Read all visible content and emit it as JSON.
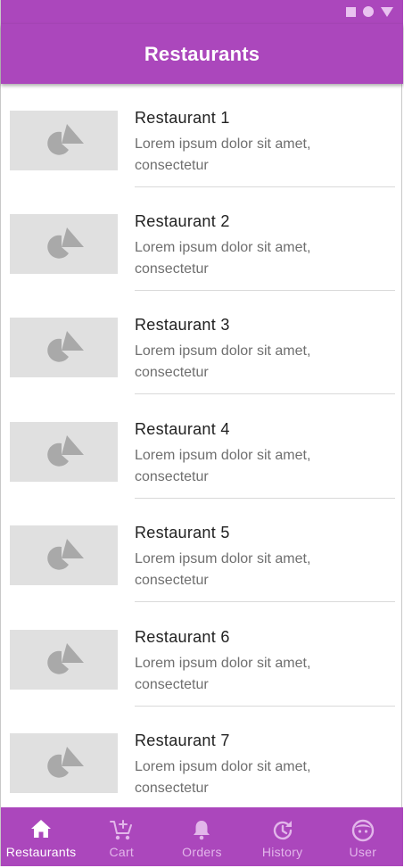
{
  "theme": {
    "primary": "#ab47bc",
    "nav_inactive": "#e2b6ea",
    "nav_active": "#ffffff",
    "placeholder_bg": "#e0e0e0",
    "placeholder_icon": "#a9a9a9"
  },
  "status_bar": {
    "icons": [
      "square-icon",
      "circle-icon",
      "triangle-icon"
    ]
  },
  "app_bar": {
    "title": "Restaurants"
  },
  "restaurants": [
    {
      "name": "Restaurant 1",
      "description": "Lorem ipsum dolor sit amet, consectetur",
      "image_icon": "image-placeholder-icon"
    },
    {
      "name": "Restaurant 2",
      "description": "Lorem ipsum dolor sit amet, consectetur",
      "image_icon": "image-placeholder-icon"
    },
    {
      "name": "Restaurant 3",
      "description": "Lorem ipsum dolor sit amet, consectetur",
      "image_icon": "image-placeholder-icon"
    },
    {
      "name": "Restaurant 4",
      "description": "Lorem ipsum dolor sit amet, consectetur",
      "image_icon": "image-placeholder-icon"
    },
    {
      "name": "Restaurant 5",
      "description": "Lorem ipsum dolor sit amet, consectetur",
      "image_icon": "image-placeholder-icon"
    },
    {
      "name": "Restaurant 6",
      "description": "Lorem ipsum dolor sit amet, consectetur",
      "image_icon": "image-placeholder-icon"
    },
    {
      "name": "Restaurant 7",
      "description": "Lorem ipsum dolor sit amet, consectetur",
      "image_icon": "image-placeholder-icon"
    }
  ],
  "bottom_nav": {
    "items": [
      {
        "label": "Restaurants",
        "icon": "home-icon",
        "active": true
      },
      {
        "label": "Cart",
        "icon": "cart-add-icon",
        "active": false
      },
      {
        "label": "Orders",
        "icon": "bell-icon",
        "active": false
      },
      {
        "label": "History",
        "icon": "history-icon",
        "active": false
      },
      {
        "label": "User",
        "icon": "user-face-icon",
        "active": false
      }
    ]
  }
}
